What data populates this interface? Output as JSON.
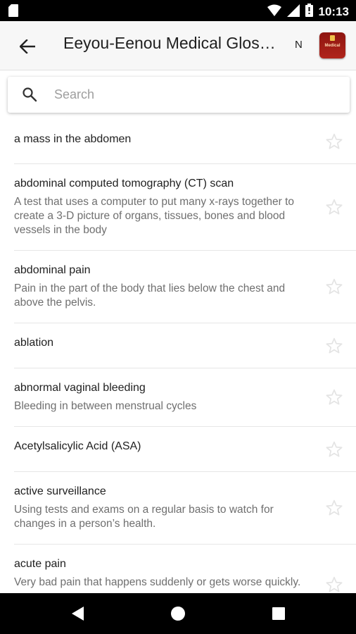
{
  "status_bar": {
    "time": "10:13",
    "icons": [
      "sd-card-icon",
      "wifi-icon",
      "signal-icon",
      "battery-icon"
    ]
  },
  "app_bar": {
    "title": "Eeyou-Eenou Medical Glossary",
    "language_toggle": "N",
    "app_icon_label": "Medical"
  },
  "search": {
    "placeholder": "Search",
    "value": ""
  },
  "entries": [
    {
      "term": "a mass in the abdomen",
      "definition": ""
    },
    {
      "term": "abdominal computed tomography (CT) scan",
      "definition": "A test that uses a computer to put many x-rays together to create a 3-D picture of organs, tissues, bones and blood vessels in the body"
    },
    {
      "term": "abdominal pain",
      "definition": "Pain in the part of the body that lies below the chest and above the pelvis."
    },
    {
      "term": "ablation",
      "definition": ""
    },
    {
      "term": "abnormal vaginal bleeding",
      "definition": "Bleeding in between menstrual cycles"
    },
    {
      "term": "Acetylsalicylic Acid (ASA)",
      "definition": ""
    },
    {
      "term": "active surveillance",
      "definition": "Using tests and exams on a regular basis to watch for changes in a person’s health."
    },
    {
      "term": "acute pain",
      "definition": "Very bad pain that happens suddenly or gets worse quickly."
    }
  ],
  "colors": {
    "app_bar": "#f7f7f7",
    "app_icon": "#a01c15",
    "divider": "#e6e6e6",
    "star": "#e4e4e4"
  }
}
